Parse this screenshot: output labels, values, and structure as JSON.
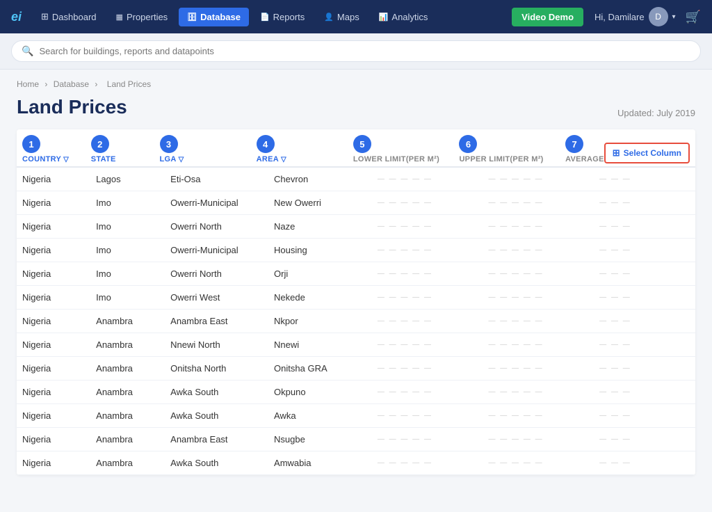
{
  "brand": {
    "logo": "ei",
    "accent_color": "#4fc3f7"
  },
  "navbar": {
    "items": [
      {
        "id": "dashboard",
        "label": "Dashboard",
        "icon": "dashboard-icon",
        "active": false
      },
      {
        "id": "properties",
        "label": "Properties",
        "icon": "properties-icon",
        "active": false
      },
      {
        "id": "database",
        "label": "Database",
        "icon": "database-icon",
        "active": true
      },
      {
        "id": "reports",
        "label": "Reports",
        "icon": "reports-icon",
        "active": false
      },
      {
        "id": "maps",
        "label": "Maps",
        "icon": "maps-icon",
        "active": false
      },
      {
        "id": "analytics",
        "label": "Analytics",
        "icon": "analytics-icon",
        "active": false
      }
    ],
    "video_demo_label": "Video Demo",
    "user_greeting": "Hi, Damilare"
  },
  "search": {
    "placeholder": "Search for buildings, reports and datapoints"
  },
  "breadcrumb": {
    "items": [
      "Home",
      "Database",
      "Land Prices"
    ]
  },
  "page": {
    "title": "Land Prices",
    "updated": "Updated: July 2019"
  },
  "select_column_button": "Select Column",
  "columns": [
    {
      "number": "1",
      "label": "COUNTRY",
      "has_filter": true,
      "gray": false
    },
    {
      "number": "2",
      "label": "STATE",
      "has_filter": false,
      "gray": false
    },
    {
      "number": "3",
      "label": "LGA",
      "has_filter": true,
      "gray": false
    },
    {
      "number": "4",
      "label": "AREA",
      "has_filter": true,
      "gray": false
    },
    {
      "number": "5",
      "label": "LOWER LIMIT(PER M²)",
      "has_filter": false,
      "gray": true
    },
    {
      "number": "6",
      "label": "UPPER LIMIT(PER M²)",
      "has_filter": false,
      "gray": true
    },
    {
      "number": "7",
      "label": "AVERAGE",
      "has_filter": false,
      "gray": true
    }
  ],
  "table": {
    "rows": [
      {
        "country": "Nigeria",
        "state": "Lagos",
        "lga": "Eti-Osa",
        "area": "Chevron",
        "lower": "●●●●●●●●●●",
        "upper": "●●●●●●●●●●",
        "avg": "●●●●●●●●"
      },
      {
        "country": "Nigeria",
        "state": "Imo",
        "lga": "Owerri-Municipal",
        "area": "New Owerri",
        "lower": "●●●●●●●●●●",
        "upper": "●●●●●●●●●●",
        "avg": "●●●●●●●●"
      },
      {
        "country": "Nigeria",
        "state": "Imo",
        "lga": "Owerri North",
        "area": "Naze",
        "lower": "●●●●●●●●●●",
        "upper": "●●●●●●●●●●",
        "avg": "●●●●●●●●"
      },
      {
        "country": "Nigeria",
        "state": "Imo",
        "lga": "Owerri-Municipal",
        "area": "Housing",
        "lower": "●●●●●●●●●●",
        "upper": "●●●●●●●●●●",
        "avg": "●●●●●●●●"
      },
      {
        "country": "Nigeria",
        "state": "Imo",
        "lga": "Owerri North",
        "area": "Orji",
        "lower": "●●●●●●●●●●",
        "upper": "●●●●●●●●●●",
        "avg": "●●●●●●●●"
      },
      {
        "country": "Nigeria",
        "state": "Imo",
        "lga": "Owerri West",
        "area": "Nekede",
        "lower": "●●●●●●●●●●",
        "upper": "●●●●●●●●●●",
        "avg": "●●●●●●●●"
      },
      {
        "country": "Nigeria",
        "state": "Anambra",
        "lga": "Anambra East",
        "area": "Nkpor",
        "lower": "●●●●●●●●●●",
        "upper": "●●●●●●●●●●",
        "avg": "●●●●●●●●"
      },
      {
        "country": "Nigeria",
        "state": "Anambra",
        "lga": "Nnewi North",
        "area": "Nnewi",
        "lower": "●●●●●●●●●●",
        "upper": "●●●●●●●●●●",
        "avg": "●●●●●●●●"
      },
      {
        "country": "Nigeria",
        "state": "Anambra",
        "lga": "Onitsha North",
        "area": "Onitsha GRA",
        "lower": "●●●●●●●●●●",
        "upper": "●●●●●●●●●●",
        "avg": "●●●●●●●●"
      },
      {
        "country": "Nigeria",
        "state": "Anambra",
        "lga": "Awka South",
        "area": "Okpuno",
        "lower": "●●●●●●●●●●",
        "upper": "●●●●●●●●●●",
        "avg": "●●●●●●●●"
      },
      {
        "country": "Nigeria",
        "state": "Anambra",
        "lga": "Awka South",
        "area": "Awka",
        "lower": "●●●●●●●●●●",
        "upper": "●●●●●●●●●●",
        "avg": "●●●●●●●●"
      },
      {
        "country": "Nigeria",
        "state": "Anambra",
        "lga": "Anambra East",
        "area": "Nsugbe",
        "lower": "●●●●●●●●●●",
        "upper": "●●●●●●●●●●",
        "avg": "●●●●●●●●"
      },
      {
        "country": "Nigeria",
        "state": "Anambra",
        "lga": "Awka South",
        "area": "Amwabia",
        "lower": "●●●●●●●●●●",
        "upper": "●●●●●●●●●●",
        "avg": "●●●●●●●●"
      }
    ]
  }
}
